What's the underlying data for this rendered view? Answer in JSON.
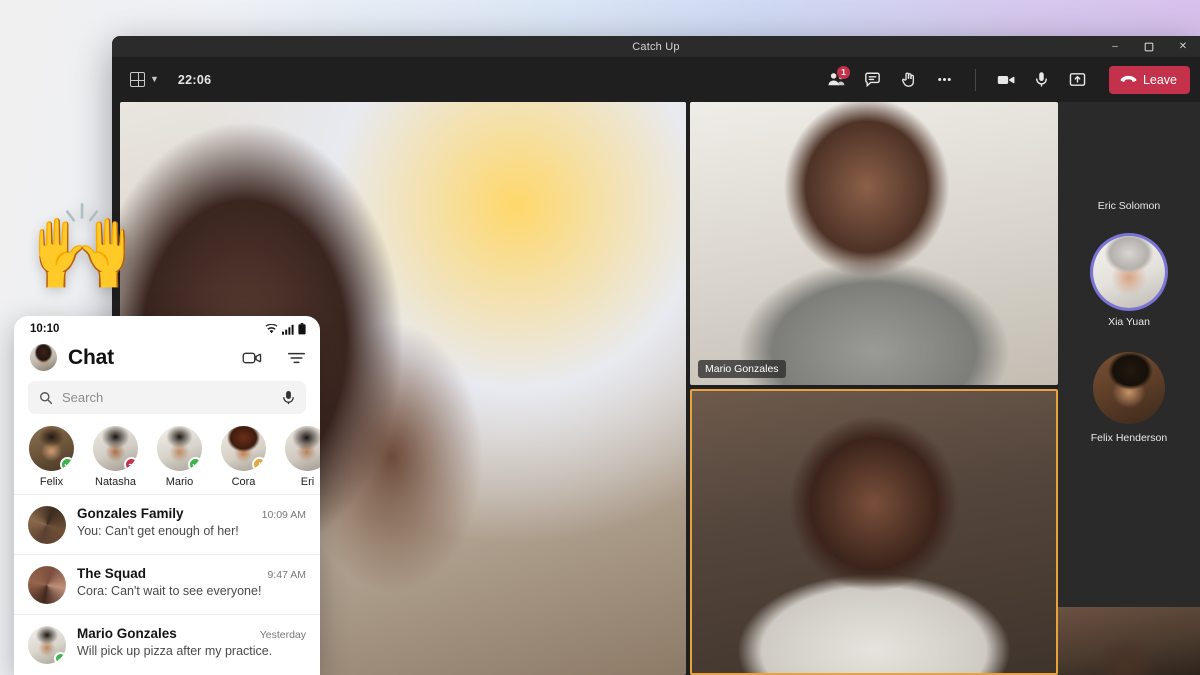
{
  "window": {
    "title": "Catch Up",
    "controls": {
      "minimize": "–",
      "maximize": "❐",
      "close": "✕"
    }
  },
  "toolbar": {
    "grid_view_label": "gallery-view",
    "call_time": "22:06",
    "people_badge": "1",
    "leave_label": "Leave",
    "accent_leave": "#c4314b",
    "buttons": [
      {
        "name": "people-button",
        "icon": "people-icon",
        "badge": "1"
      },
      {
        "name": "chat-button",
        "icon": "chat-bubble-icon"
      },
      {
        "name": "raise-hand-button",
        "icon": "raise-hand-icon"
      },
      {
        "name": "more-options-button",
        "icon": "ellipsis-icon"
      },
      {
        "name": "camera-button",
        "icon": "camera-icon"
      },
      {
        "name": "microphone-button",
        "icon": "microphone-icon"
      },
      {
        "name": "share-screen-button",
        "icon": "share-screen-icon"
      }
    ]
  },
  "stage": {
    "tiles": [
      {
        "name": "main-video-tile",
        "label": "",
        "photo": "ph-main",
        "spotlight": false
      },
      {
        "name": "video-tile-mario",
        "label": "Mario Gonzales",
        "photo": "ph-mario",
        "spotlight": false
      },
      {
        "name": "video-tile-speaker",
        "label": "",
        "photo": "ph-woman",
        "spotlight": true
      }
    ],
    "spotlight_color": "#e8a33d"
  },
  "roster": {
    "participants": [
      {
        "name": "Eric Solomon",
        "photo": "ph-eric",
        "speaking": false
      },
      {
        "name": "Xia Yuan",
        "photo": "ph-xia",
        "speaking": true
      },
      {
        "name": "Felix Henderson",
        "photo": "ph-felixh",
        "speaking": false
      }
    ],
    "speaking_ring_color": "#7a74d8"
  },
  "reaction": {
    "emoji": "🙌",
    "name": "raised-hands-reaction"
  },
  "mobile": {
    "status": {
      "time": "10:10",
      "wifi": "wifi-icon",
      "signal": "cellular-icon",
      "battery": "battery-icon"
    },
    "header": {
      "title": "Chat",
      "avatar": "ph-me",
      "video_icon": "video-camera-icon",
      "filter_icon": "filter-icon"
    },
    "search": {
      "placeholder": "Search",
      "value": "",
      "mic_icon": "microphone-icon",
      "search_icon": "search-icon"
    },
    "people": [
      {
        "name": "Felix",
        "photo": "ph-felix",
        "status": "available",
        "status_color": "#3cb44b"
      },
      {
        "name": "Natasha",
        "photo": "ph-natasha",
        "status": "busy",
        "status_color": "#c4314b"
      },
      {
        "name": "Mario",
        "photo": "ph-mariosm",
        "status": "available",
        "status_color": "#3cb44b"
      },
      {
        "name": "Cora",
        "photo": "ph-cora",
        "status": "away",
        "status_color": "#e8a33d"
      },
      {
        "name": "Eri",
        "photo": "ph-eri",
        "status": "none",
        "status_color": "transparent"
      }
    ],
    "chats": [
      {
        "title": "Gonzales Family",
        "time": "10:09 AM",
        "preview": "You: Can't get enough of her!",
        "photo": "ph-group1",
        "status_color": "transparent"
      },
      {
        "title": "The Squad",
        "time": "9:47 AM",
        "preview": "Cora: Can't wait to see everyone!",
        "photo": "ph-group2",
        "status_color": "transparent"
      },
      {
        "title": "Mario Gonzales",
        "time": "Yesterday",
        "preview": "Will pick up pizza after my practice.",
        "photo": "ph-mariog",
        "status_color": "#3cb44b"
      }
    ]
  }
}
